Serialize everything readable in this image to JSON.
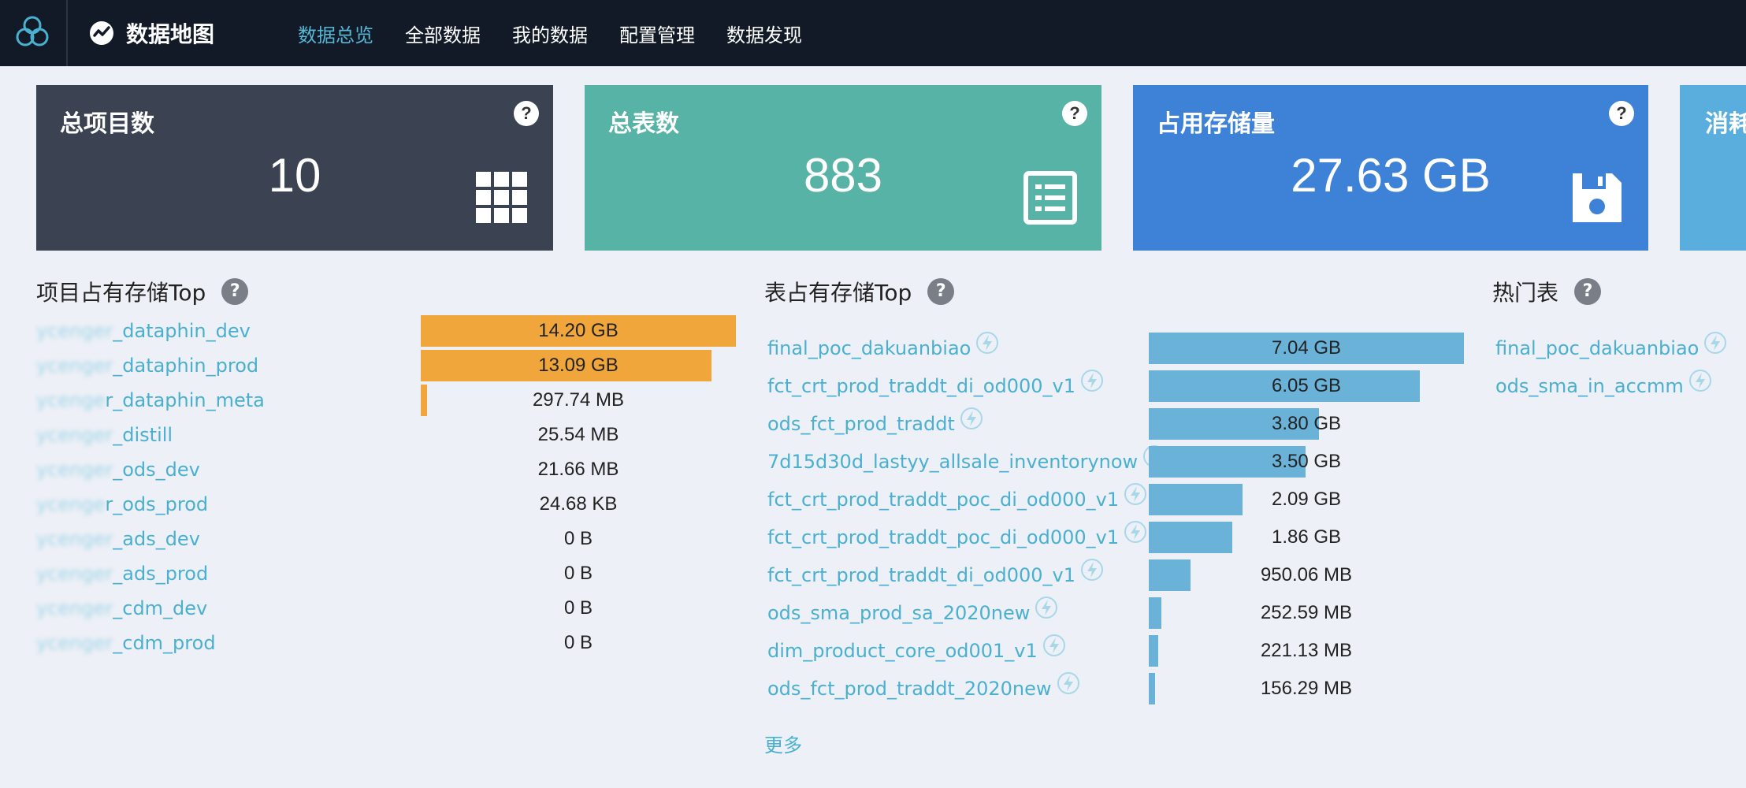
{
  "nav": {
    "app_title": "数据地图",
    "items": [
      "数据总览",
      "全部数据",
      "我的数据",
      "配置管理",
      "数据发现"
    ]
  },
  "cards": [
    {
      "title": "总项目数",
      "value": "10",
      "color": "#3b4352",
      "icon": "grid-icon"
    },
    {
      "title": "总表数",
      "value": "883",
      "color": "#56b3a5",
      "icon": "table-list-icon"
    },
    {
      "title": "占用存储量",
      "value": "27.63 GB",
      "color": "#3d82d6",
      "icon": "floppy-disk-icon"
    },
    {
      "title": "消耗",
      "value": "",
      "color": "#5aaede",
      "icon": ""
    }
  ],
  "help_symbol": "?",
  "project_storage": {
    "title": "项目占有存储Top",
    "bar_color": "#f0a63a",
    "max_value": 14.2,
    "rows": [
      {
        "label_hidden": "ycenger",
        "label_visible": "_dataphin_dev",
        "value": "14.20 GB",
        "fraction": 1.0
      },
      {
        "label_hidden": "ycenger",
        "label_visible": "_dataphin_prod",
        "value": "13.09 GB",
        "fraction": 0.922
      },
      {
        "label_hidden": "ycenge",
        "label_visible": "r_dataphin_meta",
        "value": "297.74 MB",
        "fraction": 0.021
      },
      {
        "label_hidden": "ycenger",
        "label_visible": "_distill",
        "value": "25.54 MB",
        "fraction": 0.0
      },
      {
        "label_hidden": "ycenger",
        "label_visible": "_ods_dev",
        "value": "21.66 MB",
        "fraction": 0.0
      },
      {
        "label_hidden": "ycenge",
        "label_visible": "r_ods_prod",
        "value": "24.68 KB",
        "fraction": 0.0
      },
      {
        "label_hidden": "ycenger",
        "label_visible": "_ads_dev",
        "value": "0 B",
        "fraction": 0.0
      },
      {
        "label_hidden": "ycenger",
        "label_visible": "_ads_prod",
        "value": "0 B",
        "fraction": 0.0
      },
      {
        "label_hidden": "ycenger",
        "label_visible": "_cdm_dev",
        "value": "0 B",
        "fraction": 0.0
      },
      {
        "label_hidden": "ycenger",
        "label_visible": "_cdm_prod",
        "value": "0 B",
        "fraction": 0.0
      }
    ]
  },
  "table_storage": {
    "title": "表占有存储Top",
    "bar_color": "#6ab2d8",
    "more": "更多",
    "rows": [
      {
        "label": "final_poc_dakuanbiao",
        "value": "7.04 GB",
        "fraction": 1.0
      },
      {
        "label": "fct_crt_prod_traddt_di_od000_v1",
        "value": "6.05 GB",
        "fraction": 0.859
      },
      {
        "label": "ods_fct_prod_traddt",
        "value": "3.80 GB",
        "fraction": 0.54
      },
      {
        "label": "7d15d30d_lastyy_allsale_inventorynow",
        "value": "3.50 GB",
        "fraction": 0.497
      },
      {
        "label": "fct_crt_prod_traddt_poc_di_od000_v1",
        "value": "2.09 GB",
        "fraction": 0.297
      },
      {
        "label": "fct_crt_prod_traddt_poc_di_od000_v1",
        "value": "1.86 GB",
        "fraction": 0.264
      },
      {
        "label": "fct_crt_prod_traddt_di_od000_v1",
        "value": "950.06 MB",
        "fraction": 0.132
      },
      {
        "label": "ods_sma_prod_sa_2020new",
        "value": "252.59 MB",
        "fraction": 0.04
      },
      {
        "label": "dim_product_core_od001_v1",
        "value": "221.13 MB",
        "fraction": 0.031
      },
      {
        "label": "ods_fct_prod_traddt_2020new",
        "value": "156.29 MB",
        "fraction": 0.02
      }
    ]
  },
  "hot_tables": {
    "title": "热门表",
    "rows": [
      {
        "label": "final_poc_dakuanbiao"
      },
      {
        "label": "ods_sma_in_accmm"
      }
    ]
  }
}
